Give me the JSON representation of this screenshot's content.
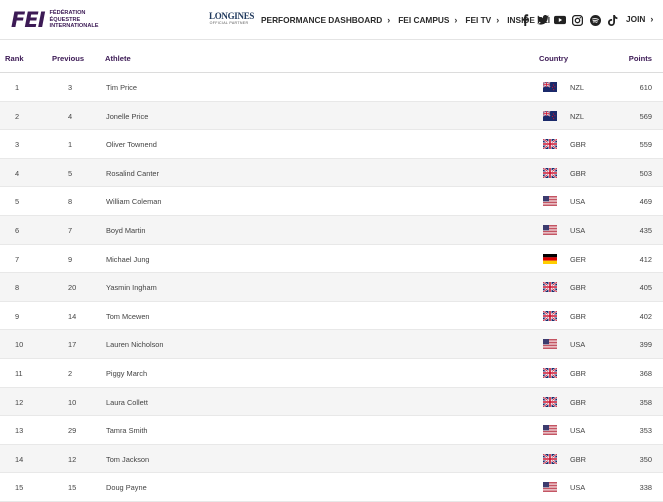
{
  "header": {
    "logo_mark": "FEI",
    "logo_lines": [
      "FÉDÉRATION",
      "ÉQUESTRE",
      "INTERNATIONALE"
    ],
    "partner_name": "LONGINES",
    "partner_sub": "OFFICIAL PARTNER",
    "nav": [
      {
        "label": "PERFORMANCE DASHBOARD"
      },
      {
        "label": "FEI CAMPUS"
      },
      {
        "label": "FEI TV"
      },
      {
        "label": "INSIDE FEI"
      }
    ],
    "social_icons": [
      "facebook-icon",
      "twitter-icon",
      "youtube-icon",
      "instagram-icon",
      "spotify-icon",
      "tiktok-icon"
    ],
    "join_label": "JOIN"
  },
  "table": {
    "columns": {
      "rank": "Rank",
      "previous": "Previous",
      "athlete": "Athlete",
      "country": "Country",
      "points": "Points"
    },
    "rows": [
      {
        "rank": "1",
        "previous": "3",
        "athlete": "Tim Price",
        "flag": "nzl",
        "country": "NZL",
        "points": "610"
      },
      {
        "rank": "2",
        "previous": "4",
        "athlete": "Jonelle Price",
        "flag": "nzl",
        "country": "NZL",
        "points": "569"
      },
      {
        "rank": "3",
        "previous": "1",
        "athlete": "Oliver Townend",
        "flag": "gbr",
        "country": "GBR",
        "points": "559"
      },
      {
        "rank": "4",
        "previous": "5",
        "athlete": "Rosalind Canter",
        "flag": "gbr",
        "country": "GBR",
        "points": "503"
      },
      {
        "rank": "5",
        "previous": "8",
        "athlete": "William Coleman",
        "flag": "usa",
        "country": "USA",
        "points": "469"
      },
      {
        "rank": "6",
        "previous": "7",
        "athlete": "Boyd Martin",
        "flag": "usa",
        "country": "USA",
        "points": "435"
      },
      {
        "rank": "7",
        "previous": "9",
        "athlete": "Michael Jung",
        "flag": "ger",
        "country": "GER",
        "points": "412"
      },
      {
        "rank": "8",
        "previous": "20",
        "athlete": "Yasmin Ingham",
        "flag": "gbr",
        "country": "GBR",
        "points": "405"
      },
      {
        "rank": "9",
        "previous": "14",
        "athlete": "Tom Mcewen",
        "flag": "gbr",
        "country": "GBR",
        "points": "402"
      },
      {
        "rank": "10",
        "previous": "17",
        "athlete": "Lauren Nicholson",
        "flag": "usa",
        "country": "USA",
        "points": "399"
      },
      {
        "rank": "11",
        "previous": "2",
        "athlete": "Piggy March",
        "flag": "gbr",
        "country": "GBR",
        "points": "368"
      },
      {
        "rank": "12",
        "previous": "10",
        "athlete": "Laura Collett",
        "flag": "gbr",
        "country": "GBR",
        "points": "358"
      },
      {
        "rank": "13",
        "previous": "29",
        "athlete": "Tamra Smith",
        "flag": "usa",
        "country": "USA",
        "points": "353"
      },
      {
        "rank": "14",
        "previous": "12",
        "athlete": "Tom Jackson",
        "flag": "gbr",
        "country": "GBR",
        "points": "350"
      },
      {
        "rank": "15",
        "previous": "15",
        "athlete": "Doug Payne",
        "flag": "usa",
        "country": "USA",
        "points": "338"
      }
    ]
  },
  "colors": {
    "brand": "#3c1a55",
    "row_alt": "#f5f5f5",
    "border": "#e8e8e8"
  }
}
